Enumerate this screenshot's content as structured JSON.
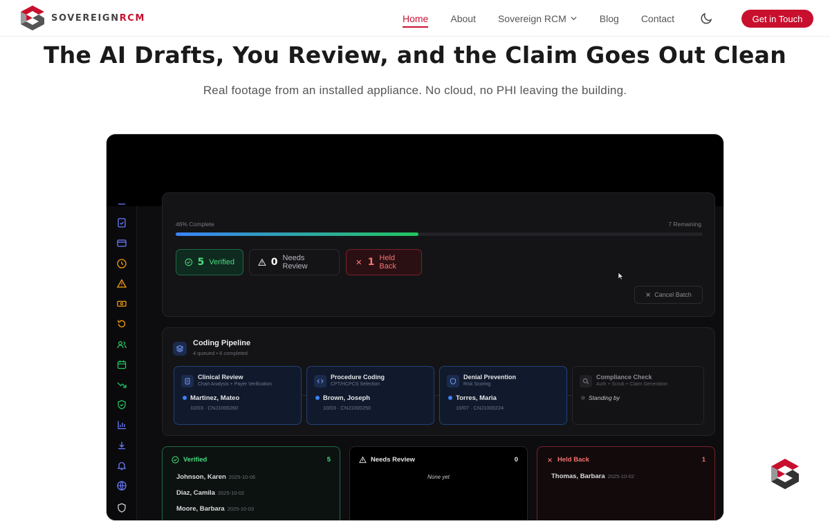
{
  "brand": {
    "logo_part1": "SOVEREIGN",
    "logo_part2": "RCM",
    "accent": "#c8102e"
  },
  "nav": {
    "items": [
      {
        "label": "Home",
        "active": true
      },
      {
        "label": "About"
      },
      {
        "label": "Sovereign RCM",
        "dropdown": true
      },
      {
        "label": "Blog"
      },
      {
        "label": "Contact"
      }
    ],
    "theme_icon": "moon-icon",
    "cta_label": "Get in Touch"
  },
  "hero": {
    "title": "The AI Drafts, You Review, and the Claim Goes Out Clean",
    "subtitle": "Real footage from an installed appliance. No cloud, no PHI leaving the building."
  },
  "app": {
    "progress": {
      "label": "46% Complete",
      "remaining": "7 Remaining",
      "fraction": 0.46
    },
    "pills": [
      {
        "count": "5",
        "label": "Verified"
      },
      {
        "count": "0",
        "label": "Needs Review"
      },
      {
        "count": "1",
        "label": "Held Back"
      }
    ],
    "cancel_label": "Cancel Batch",
    "pipeline": {
      "title": "Coding Pipeline",
      "subtitle": "4 queued • 6 completed",
      "stages": [
        {
          "title": "Clinical Review",
          "sub": "Chart Analysis + Payer Verification",
          "patient": "Martinez, Mateo",
          "meta": "10/03 · CNJ1000260"
        },
        {
          "title": "Procedure Coding",
          "sub": "CPT/HCPCS Selection",
          "patient": "Brown, Joseph",
          "meta": "10/03 · CNJ1000250"
        },
        {
          "title": "Denial Prevention",
          "sub": "Risk Scoring",
          "patient": "Torres, Maria",
          "meta": "10/07 · CNJ1000224"
        },
        {
          "title": "Compliance Check",
          "sub": "Auth + Scrub + Claim Generation",
          "patient": "Standing by"
        }
      ]
    },
    "columns": [
      {
        "title": "Verified",
        "count": "5",
        "rows": [
          {
            "name": "Johnson, Karen",
            "date": "2025-10-06"
          },
          {
            "name": "Diaz, Camila",
            "date": "2025-10-02"
          },
          {
            "name": "Moore, Barbara",
            "date": "2025-10-03"
          }
        ]
      },
      {
        "title": "Needs Review",
        "count": "0",
        "empty": "None yet"
      },
      {
        "title": "Held Back",
        "count": "1",
        "rows": [
          {
            "name": "Thomas, Barbara",
            "date": "2025-10-02"
          }
        ]
      }
    ]
  }
}
